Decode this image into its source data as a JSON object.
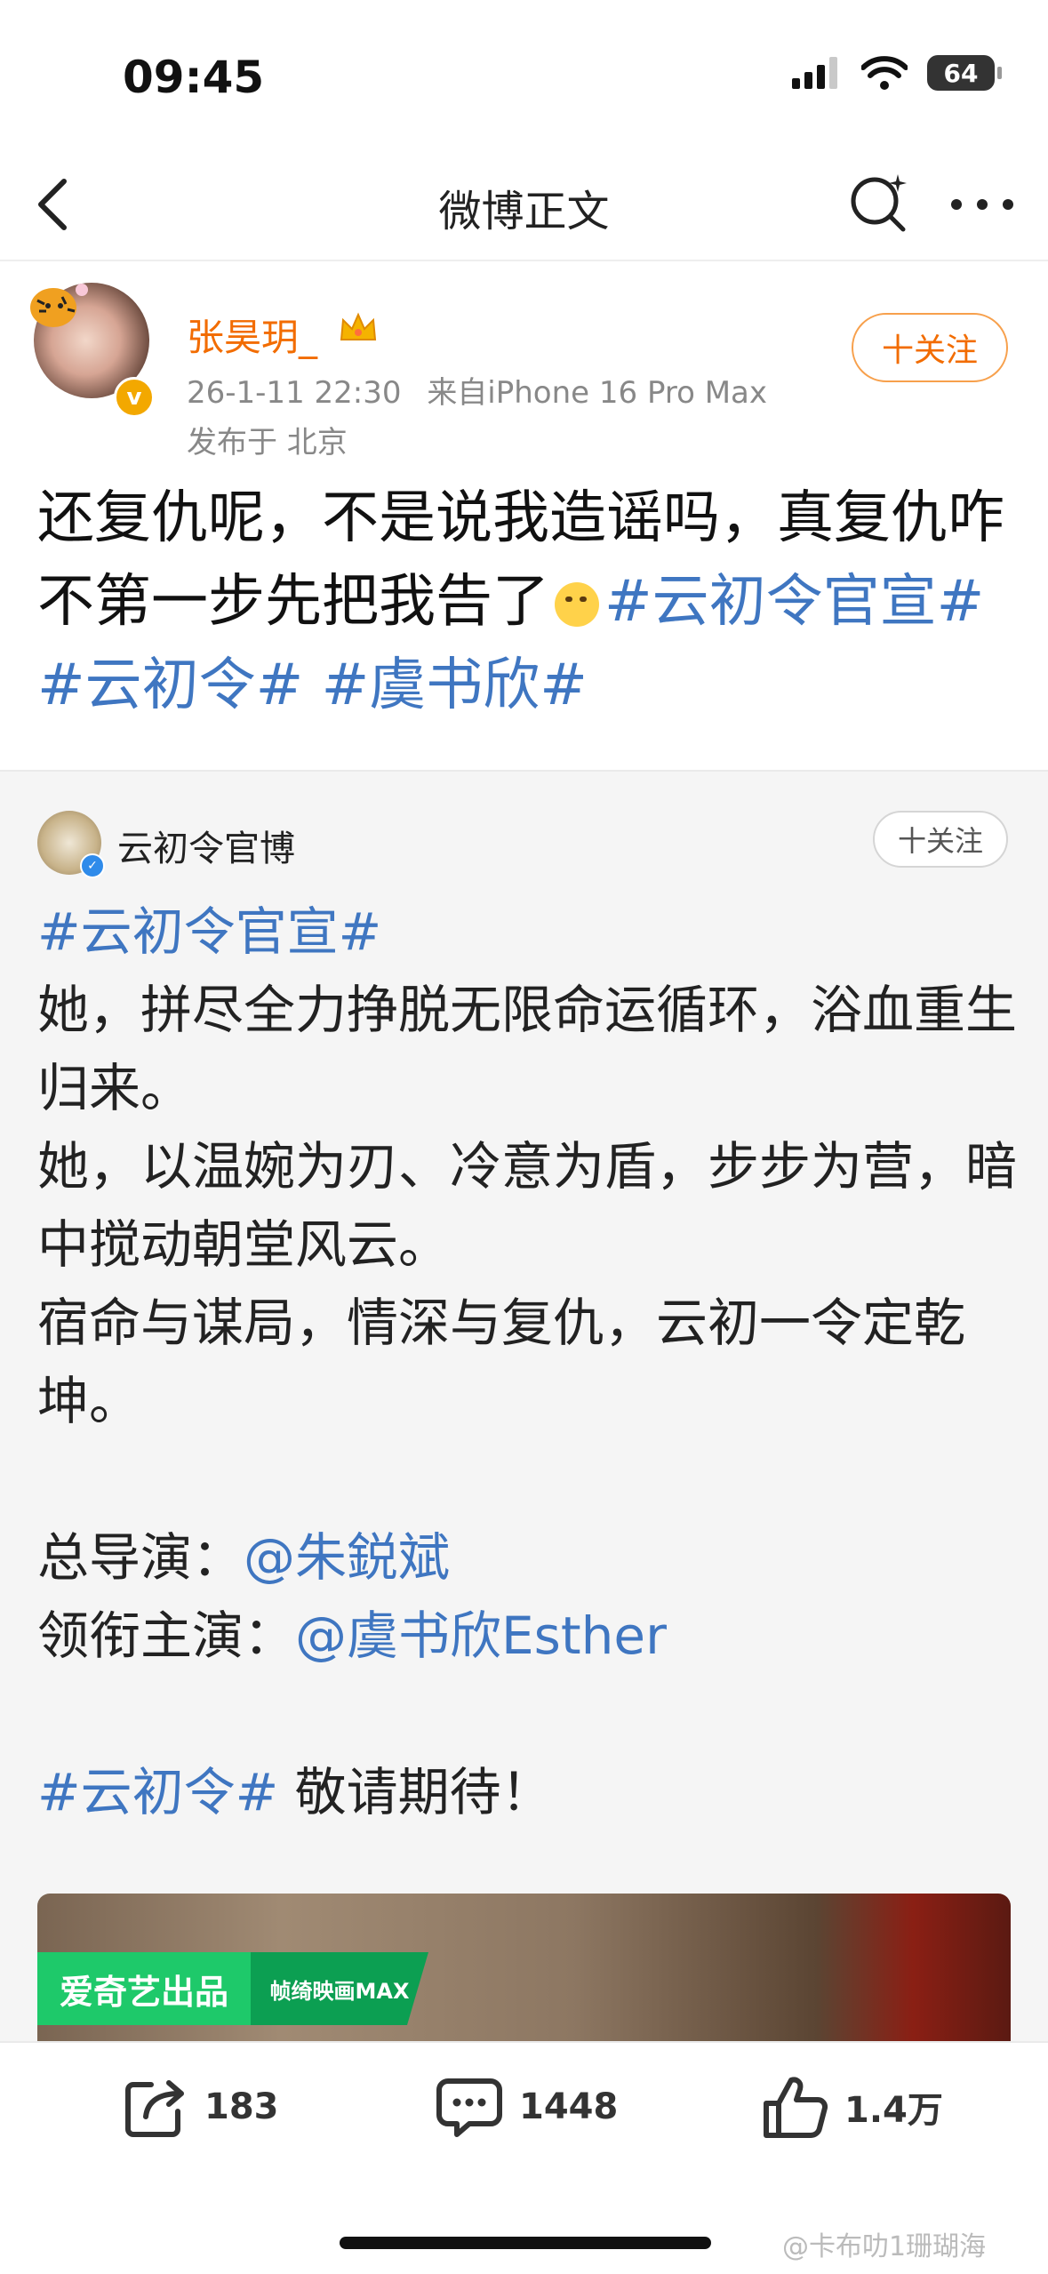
{
  "status_bar": {
    "time": "09:45",
    "battery": "64"
  },
  "nav": {
    "title": "微博正文"
  },
  "post": {
    "username": "张昊玥_",
    "timestamp": "26-1-11 22:30",
    "source": "来自iPhone 16 Pro Max",
    "location": "发布于 北京",
    "follow_label": "十关注",
    "text_before": "还复仇呢，不是说我造谣吗，真复仇咋不第一步先把我告了",
    "tags": [
      "#云初令官宣#",
      "#云初令#",
      "#虞书欣#"
    ]
  },
  "repost": {
    "author": "云初令官博",
    "follow_label": "十关注",
    "tag_official": "#云初令官宣#",
    "line1": "她，拼尽全力挣脱无限命运循环，浴血重生归来。",
    "line2": "她，以温婉为刃、冷意为盾，步步为营，暗中搅动朝堂风云。",
    "line3": "宿命与谋局，情深与复仇，云初一令定乾坤。",
    "director_label": "总导演：",
    "director_name": "@朱鋭斌",
    "lead_label": "领衔主演：",
    "lead_name": "@虞书欣Esther",
    "tag_show": "#云初令#",
    "closing": " 敬请期待！",
    "media_badges": [
      "爱奇艺出品",
      "帧绮映画MAX"
    ]
  },
  "actions": {
    "reposts": "183",
    "comments": "1448",
    "likes": "1.4万"
  },
  "watermark": "@卡布叻1珊瑚海"
}
